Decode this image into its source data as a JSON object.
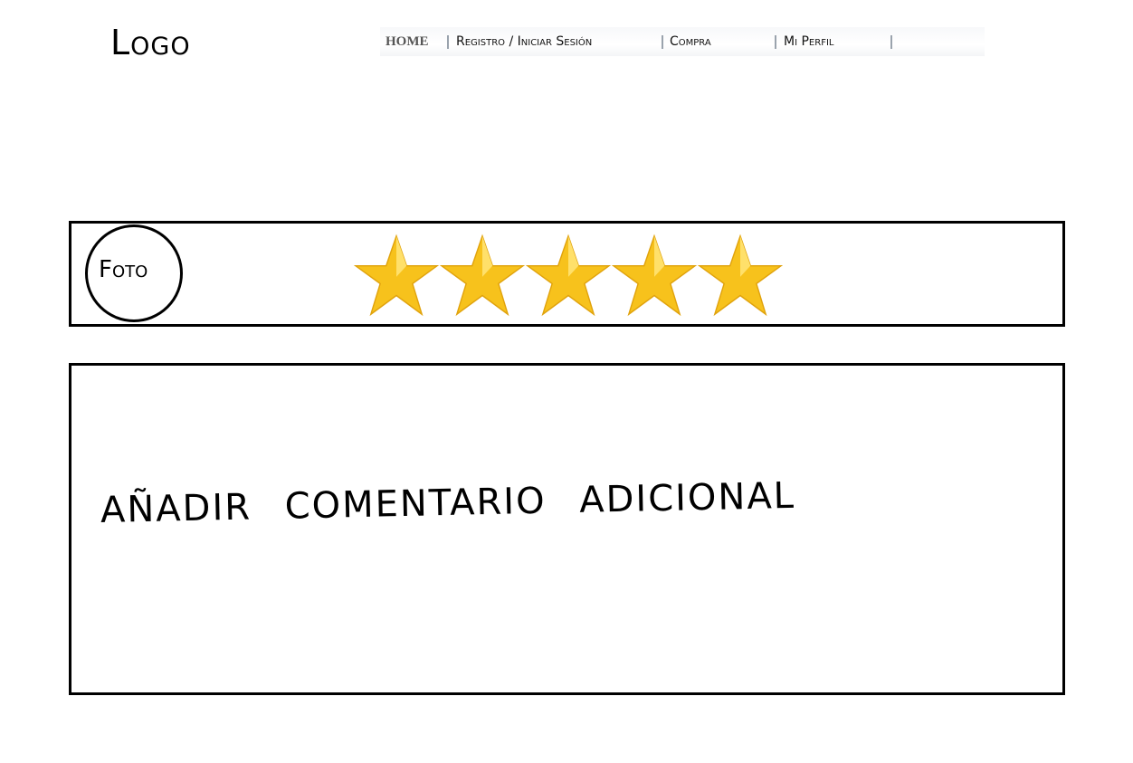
{
  "header": {
    "logo": "Logo",
    "nav": [
      {
        "label": "HOME"
      },
      {
        "label": "Registro / Iniciar Sesión"
      },
      {
        "label": "Compra"
      },
      {
        "label": "Mi Perfil"
      }
    ]
  },
  "rating": {
    "photo_label": "Foto",
    "stars_filled": 5,
    "stars_total": 5,
    "star_color": "#f7c21c"
  },
  "comment": {
    "prompt": "AÑADIR COMENTARIO ADICIONAL"
  }
}
